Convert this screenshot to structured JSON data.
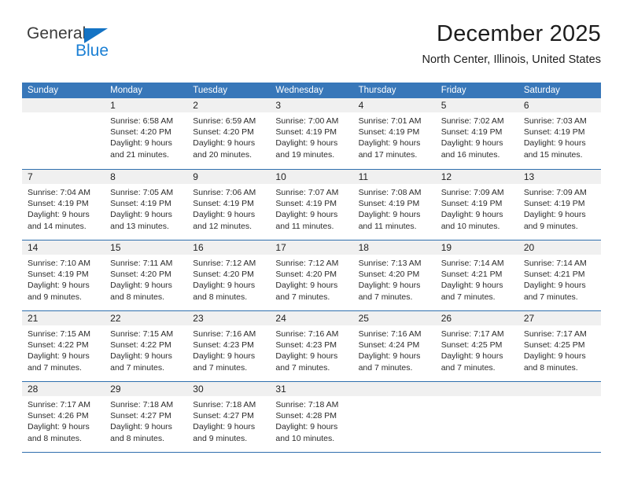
{
  "brand": {
    "name_top": "General",
    "name_bottom": "Blue",
    "accent_color": "#1a7fd4",
    "triangle_color": "#1473c4"
  },
  "header": {
    "title": "December 2025",
    "subtitle": "North Center, Illinois, United States"
  },
  "theme": {
    "header_bg": "#3877b9",
    "row_divider": "#2f6fae",
    "daynum_bg": "#f0f0f0"
  },
  "weekdays": [
    "Sunday",
    "Monday",
    "Tuesday",
    "Wednesday",
    "Thursday",
    "Friday",
    "Saturday"
  ],
  "weeks": [
    [
      {
        "day": "",
        "sunrise": "",
        "sunset": "",
        "daylight_line1": "",
        "daylight_line2": "",
        "empty": true
      },
      {
        "day": "1",
        "sunrise": "Sunrise: 6:58 AM",
        "sunset": "Sunset: 4:20 PM",
        "daylight_line1": "Daylight: 9 hours",
        "daylight_line2": "and 21 minutes."
      },
      {
        "day": "2",
        "sunrise": "Sunrise: 6:59 AM",
        "sunset": "Sunset: 4:20 PM",
        "daylight_line1": "Daylight: 9 hours",
        "daylight_line2": "and 20 minutes."
      },
      {
        "day": "3",
        "sunrise": "Sunrise: 7:00 AM",
        "sunset": "Sunset: 4:19 PM",
        "daylight_line1": "Daylight: 9 hours",
        "daylight_line2": "and 19 minutes."
      },
      {
        "day": "4",
        "sunrise": "Sunrise: 7:01 AM",
        "sunset": "Sunset: 4:19 PM",
        "daylight_line1": "Daylight: 9 hours",
        "daylight_line2": "and 17 minutes."
      },
      {
        "day": "5",
        "sunrise": "Sunrise: 7:02 AM",
        "sunset": "Sunset: 4:19 PM",
        "daylight_line1": "Daylight: 9 hours",
        "daylight_line2": "and 16 minutes."
      },
      {
        "day": "6",
        "sunrise": "Sunrise: 7:03 AM",
        "sunset": "Sunset: 4:19 PM",
        "daylight_line1": "Daylight: 9 hours",
        "daylight_line2": "and 15 minutes."
      }
    ],
    [
      {
        "day": "7",
        "sunrise": "Sunrise: 7:04 AM",
        "sunset": "Sunset: 4:19 PM",
        "daylight_line1": "Daylight: 9 hours",
        "daylight_line2": "and 14 minutes."
      },
      {
        "day": "8",
        "sunrise": "Sunrise: 7:05 AM",
        "sunset": "Sunset: 4:19 PM",
        "daylight_line1": "Daylight: 9 hours",
        "daylight_line2": "and 13 minutes."
      },
      {
        "day": "9",
        "sunrise": "Sunrise: 7:06 AM",
        "sunset": "Sunset: 4:19 PM",
        "daylight_line1": "Daylight: 9 hours",
        "daylight_line2": "and 12 minutes."
      },
      {
        "day": "10",
        "sunrise": "Sunrise: 7:07 AM",
        "sunset": "Sunset: 4:19 PM",
        "daylight_line1": "Daylight: 9 hours",
        "daylight_line2": "and 11 minutes."
      },
      {
        "day": "11",
        "sunrise": "Sunrise: 7:08 AM",
        "sunset": "Sunset: 4:19 PM",
        "daylight_line1": "Daylight: 9 hours",
        "daylight_line2": "and 11 minutes."
      },
      {
        "day": "12",
        "sunrise": "Sunrise: 7:09 AM",
        "sunset": "Sunset: 4:19 PM",
        "daylight_line1": "Daylight: 9 hours",
        "daylight_line2": "and 10 minutes."
      },
      {
        "day": "13",
        "sunrise": "Sunrise: 7:09 AM",
        "sunset": "Sunset: 4:19 PM",
        "daylight_line1": "Daylight: 9 hours",
        "daylight_line2": "and 9 minutes."
      }
    ],
    [
      {
        "day": "14",
        "sunrise": "Sunrise: 7:10 AM",
        "sunset": "Sunset: 4:19 PM",
        "daylight_line1": "Daylight: 9 hours",
        "daylight_line2": "and 9 minutes."
      },
      {
        "day": "15",
        "sunrise": "Sunrise: 7:11 AM",
        "sunset": "Sunset: 4:20 PM",
        "daylight_line1": "Daylight: 9 hours",
        "daylight_line2": "and 8 minutes."
      },
      {
        "day": "16",
        "sunrise": "Sunrise: 7:12 AM",
        "sunset": "Sunset: 4:20 PM",
        "daylight_line1": "Daylight: 9 hours",
        "daylight_line2": "and 8 minutes."
      },
      {
        "day": "17",
        "sunrise": "Sunrise: 7:12 AM",
        "sunset": "Sunset: 4:20 PM",
        "daylight_line1": "Daylight: 9 hours",
        "daylight_line2": "and 7 minutes."
      },
      {
        "day": "18",
        "sunrise": "Sunrise: 7:13 AM",
        "sunset": "Sunset: 4:20 PM",
        "daylight_line1": "Daylight: 9 hours",
        "daylight_line2": "and 7 minutes."
      },
      {
        "day": "19",
        "sunrise": "Sunrise: 7:14 AM",
        "sunset": "Sunset: 4:21 PM",
        "daylight_line1": "Daylight: 9 hours",
        "daylight_line2": "and 7 minutes."
      },
      {
        "day": "20",
        "sunrise": "Sunrise: 7:14 AM",
        "sunset": "Sunset: 4:21 PM",
        "daylight_line1": "Daylight: 9 hours",
        "daylight_line2": "and 7 minutes."
      }
    ],
    [
      {
        "day": "21",
        "sunrise": "Sunrise: 7:15 AM",
        "sunset": "Sunset: 4:22 PM",
        "daylight_line1": "Daylight: 9 hours",
        "daylight_line2": "and 7 minutes."
      },
      {
        "day": "22",
        "sunrise": "Sunrise: 7:15 AM",
        "sunset": "Sunset: 4:22 PM",
        "daylight_line1": "Daylight: 9 hours",
        "daylight_line2": "and 7 minutes."
      },
      {
        "day": "23",
        "sunrise": "Sunrise: 7:16 AM",
        "sunset": "Sunset: 4:23 PM",
        "daylight_line1": "Daylight: 9 hours",
        "daylight_line2": "and 7 minutes."
      },
      {
        "day": "24",
        "sunrise": "Sunrise: 7:16 AM",
        "sunset": "Sunset: 4:23 PM",
        "daylight_line1": "Daylight: 9 hours",
        "daylight_line2": "and 7 minutes."
      },
      {
        "day": "25",
        "sunrise": "Sunrise: 7:16 AM",
        "sunset": "Sunset: 4:24 PM",
        "daylight_line1": "Daylight: 9 hours",
        "daylight_line2": "and 7 minutes."
      },
      {
        "day": "26",
        "sunrise": "Sunrise: 7:17 AM",
        "sunset": "Sunset: 4:25 PM",
        "daylight_line1": "Daylight: 9 hours",
        "daylight_line2": "and 7 minutes."
      },
      {
        "day": "27",
        "sunrise": "Sunrise: 7:17 AM",
        "sunset": "Sunset: 4:25 PM",
        "daylight_line1": "Daylight: 9 hours",
        "daylight_line2": "and 8 minutes."
      }
    ],
    [
      {
        "day": "28",
        "sunrise": "Sunrise: 7:17 AM",
        "sunset": "Sunset: 4:26 PM",
        "daylight_line1": "Daylight: 9 hours",
        "daylight_line2": "and 8 minutes."
      },
      {
        "day": "29",
        "sunrise": "Sunrise: 7:18 AM",
        "sunset": "Sunset: 4:27 PM",
        "daylight_line1": "Daylight: 9 hours",
        "daylight_line2": "and 8 minutes."
      },
      {
        "day": "30",
        "sunrise": "Sunrise: 7:18 AM",
        "sunset": "Sunset: 4:27 PM",
        "daylight_line1": "Daylight: 9 hours",
        "daylight_line2": "and 9 minutes."
      },
      {
        "day": "31",
        "sunrise": "Sunrise: 7:18 AM",
        "sunset": "Sunset: 4:28 PM",
        "daylight_line1": "Daylight: 9 hours",
        "daylight_line2": "and 10 minutes."
      },
      {
        "day": "",
        "sunrise": "",
        "sunset": "",
        "daylight_line1": "",
        "daylight_line2": "",
        "empty": true
      },
      {
        "day": "",
        "sunrise": "",
        "sunset": "",
        "daylight_line1": "",
        "daylight_line2": "",
        "empty": true
      },
      {
        "day": "",
        "sunrise": "",
        "sunset": "",
        "daylight_line1": "",
        "daylight_line2": "",
        "empty": true
      }
    ]
  ]
}
